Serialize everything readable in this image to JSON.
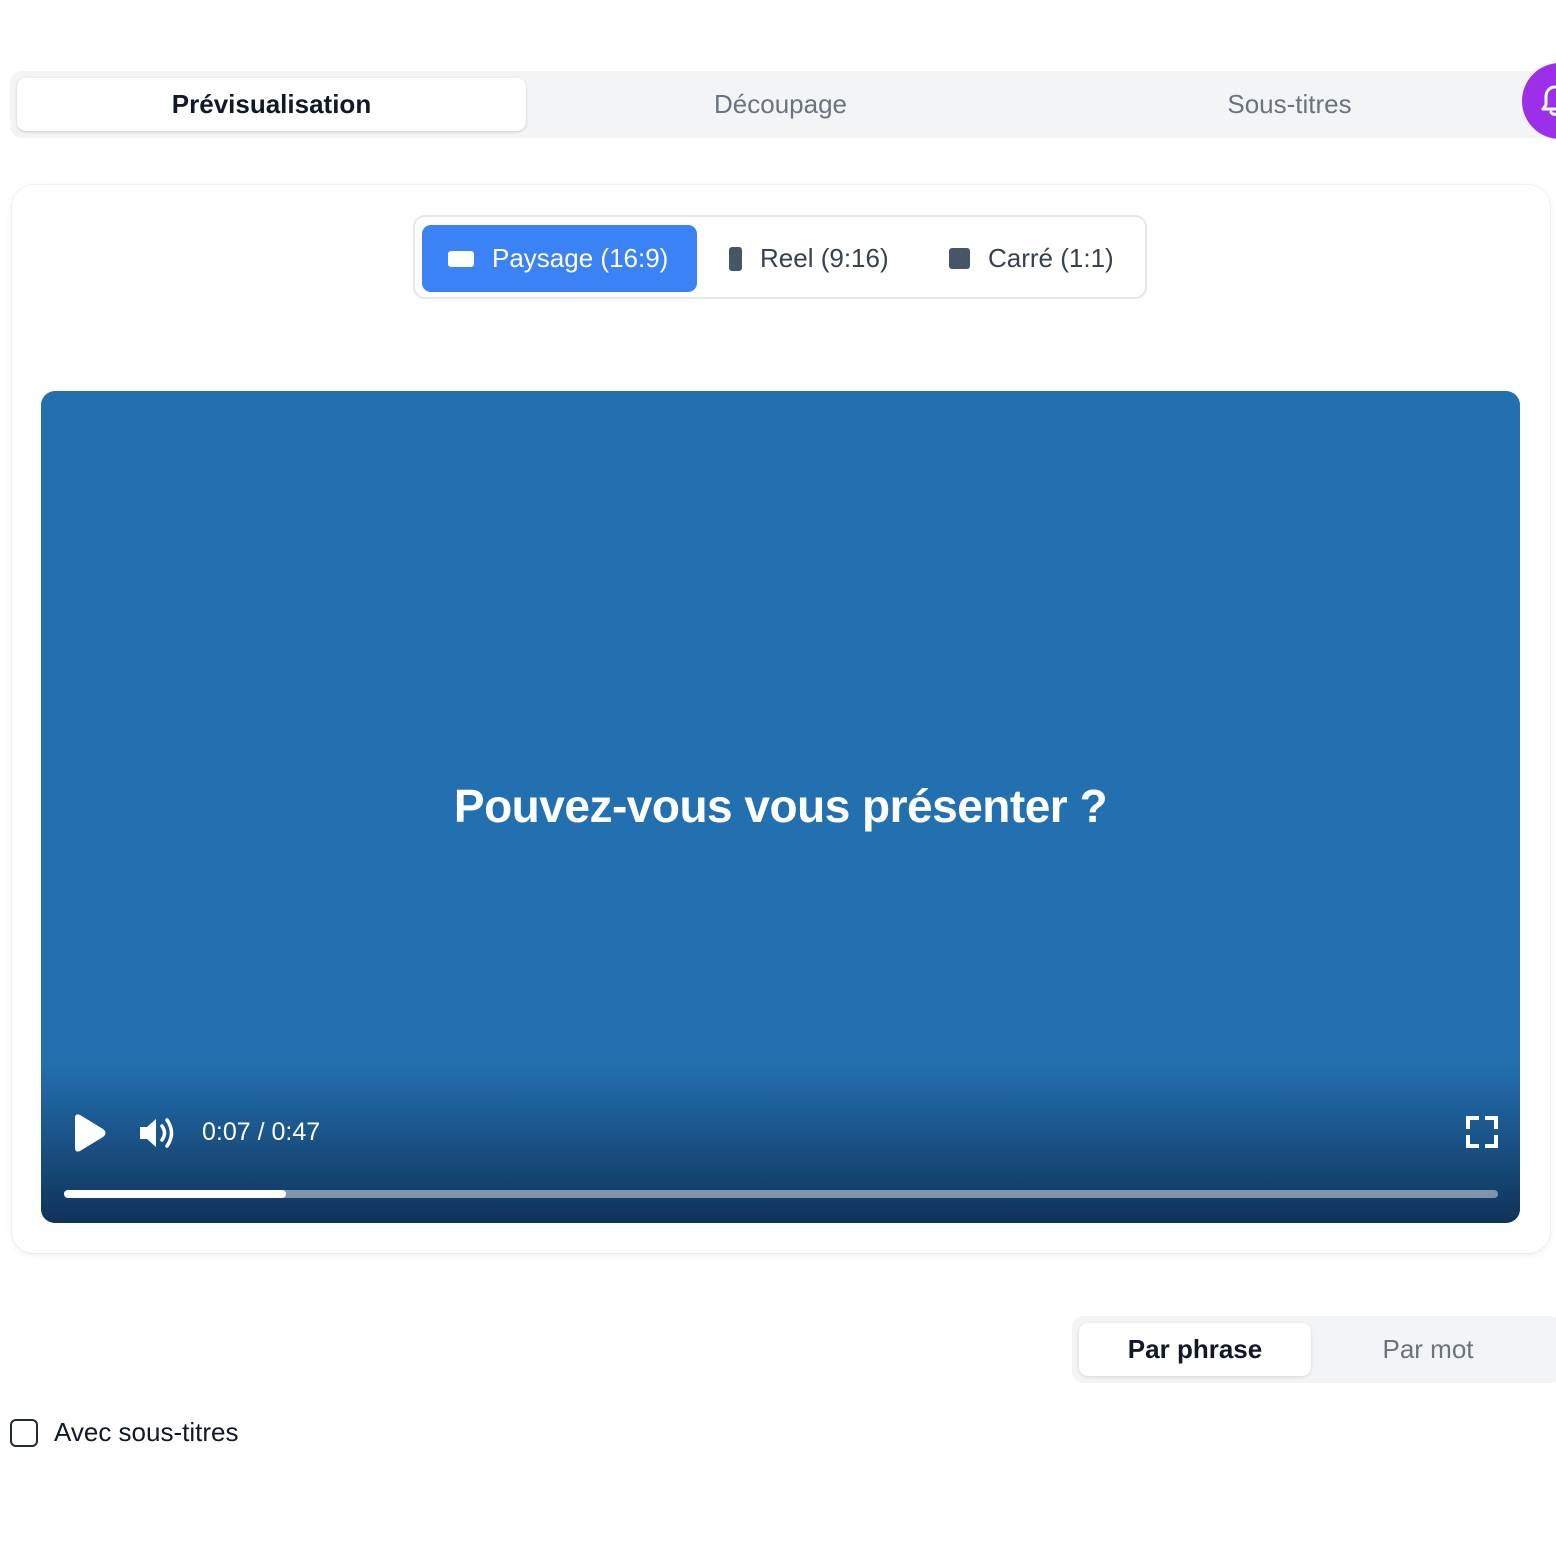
{
  "top_tabs": [
    {
      "label": "Prévisualisation",
      "active": true
    },
    {
      "label": "Découpage",
      "active": false
    },
    {
      "label": "Sous-titres",
      "active": false
    }
  ],
  "notification_icon": "bell-icon",
  "formats": [
    {
      "label": "Paysage (16:9)",
      "icon": "landscape-icon",
      "active": true
    },
    {
      "label": "Reel (9:16)",
      "icon": "portrait-icon",
      "active": false
    },
    {
      "label": "Carré (1:1)",
      "icon": "square-icon",
      "active": false
    }
  ],
  "video": {
    "caption": "Pouvez-vous vous présenter ?",
    "time_display": "0:07 / 0:47",
    "progress": 0.155,
    "background_color": "#2270b0"
  },
  "subtitle_mode": [
    {
      "label": "Par phrase",
      "active": true
    },
    {
      "label": "Par mot",
      "active": false
    }
  ],
  "with_subtitles": {
    "label": "Avec sous-titres",
    "checked": false
  },
  "colors": {
    "accent": "#3b82f6",
    "fab": "#9b30e8"
  }
}
